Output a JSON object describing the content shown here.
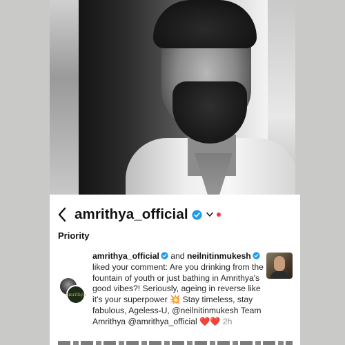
{
  "header": {
    "username": "amrithya_official",
    "icons": [
      "back-icon",
      "verified-icon",
      "chevron-down-icon",
      "live-dot"
    ]
  },
  "section": {
    "title": "Priority"
  },
  "notification": {
    "user1": "amrithya_official",
    "connector": " and ",
    "user2": "neilnitinmukesh",
    "message": "liked your comment: Are you drinking from the fountain of youth or just bathing in Amrithya's good vibes?! Seriously, ageing in reverse like it's your superpower 💥 Stay timeless, stay fabulous, Ageless-U, @neilnitinmukesh Team Amrithya @amrithya_official ❤️❤️",
    "time": "2h",
    "avatar_label": "amrithya"
  },
  "colors": {
    "verified": "#1d9bf0",
    "live_dot": "#ff3040",
    "time": "#8e8e8e"
  }
}
